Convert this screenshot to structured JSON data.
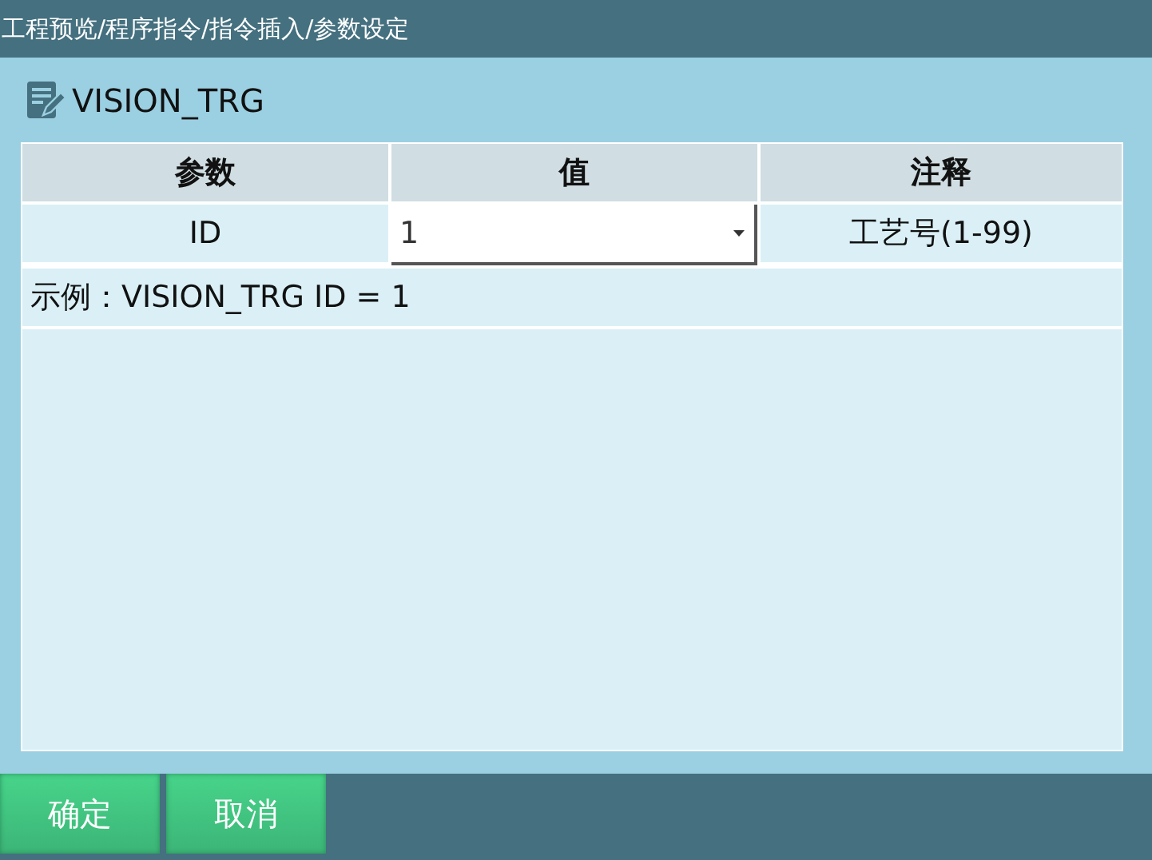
{
  "header": {
    "breadcrumb": "工程预览/程序指令/指令插入/参数设定"
  },
  "instruction": {
    "title": "VISION_TRG"
  },
  "table": {
    "columns": [
      "参数",
      "值",
      "注释"
    ],
    "rows": [
      {
        "parameter": "ID",
        "value": "1",
        "comment": "工艺号(1-99)"
      }
    ],
    "example": "示例：VISION_TRG ID = 1"
  },
  "buttons": [
    "确定",
    "取消"
  ]
}
